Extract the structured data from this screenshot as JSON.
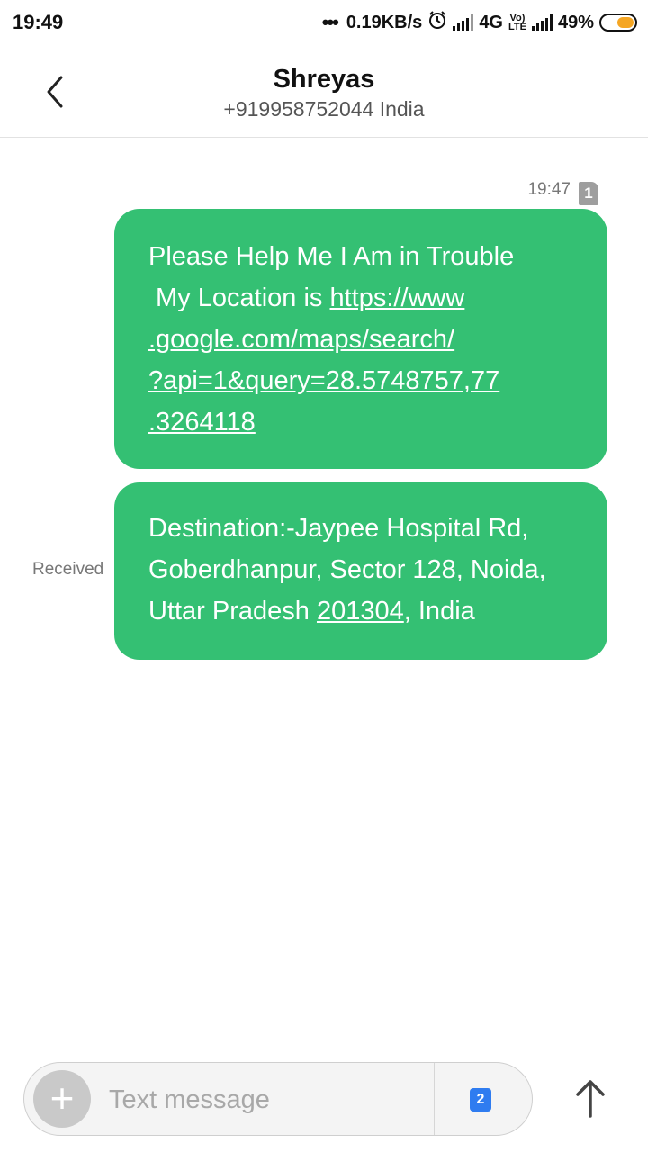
{
  "status_bar": {
    "time": "19:49",
    "dots": "•••",
    "network_speed": "0.19KB/s",
    "network_type": "4G",
    "lte_label_top": "Vo)",
    "lte_label_bottom": "LTE",
    "battery_percent": "49%",
    "battery_color": "#f5a623"
  },
  "header": {
    "back_icon": "chevron-left-icon",
    "contact_name": "Shreyas",
    "contact_number": "+919958752044 India"
  },
  "conversation": {
    "timestamp": "19:47",
    "sim_badge": "1",
    "bubble_color": "#34c073",
    "messages": [
      {
        "lines": [
          "Please Help Me I Am in Trouble",
          " My Location is ",
          "https://www",
          ".google.com/maps/search/",
          "?api=1&query=28.5748757,77",
          ".3264118"
        ]
      },
      {
        "status": "Received",
        "lines": [
          "Destination:-Jaypee Hospital Rd,",
          "Goberdhanpur, Sector 128, Noida,",
          "Uttar Pradesh ",
          "201304",
          ", India"
        ]
      }
    ]
  },
  "composer": {
    "add_icon": "plus-icon",
    "add_symbol": "+",
    "placeholder": "Text message",
    "value": "",
    "sim_select": "2",
    "sim_color": "#2f7cf0",
    "send_icon": "arrow-up-icon"
  }
}
